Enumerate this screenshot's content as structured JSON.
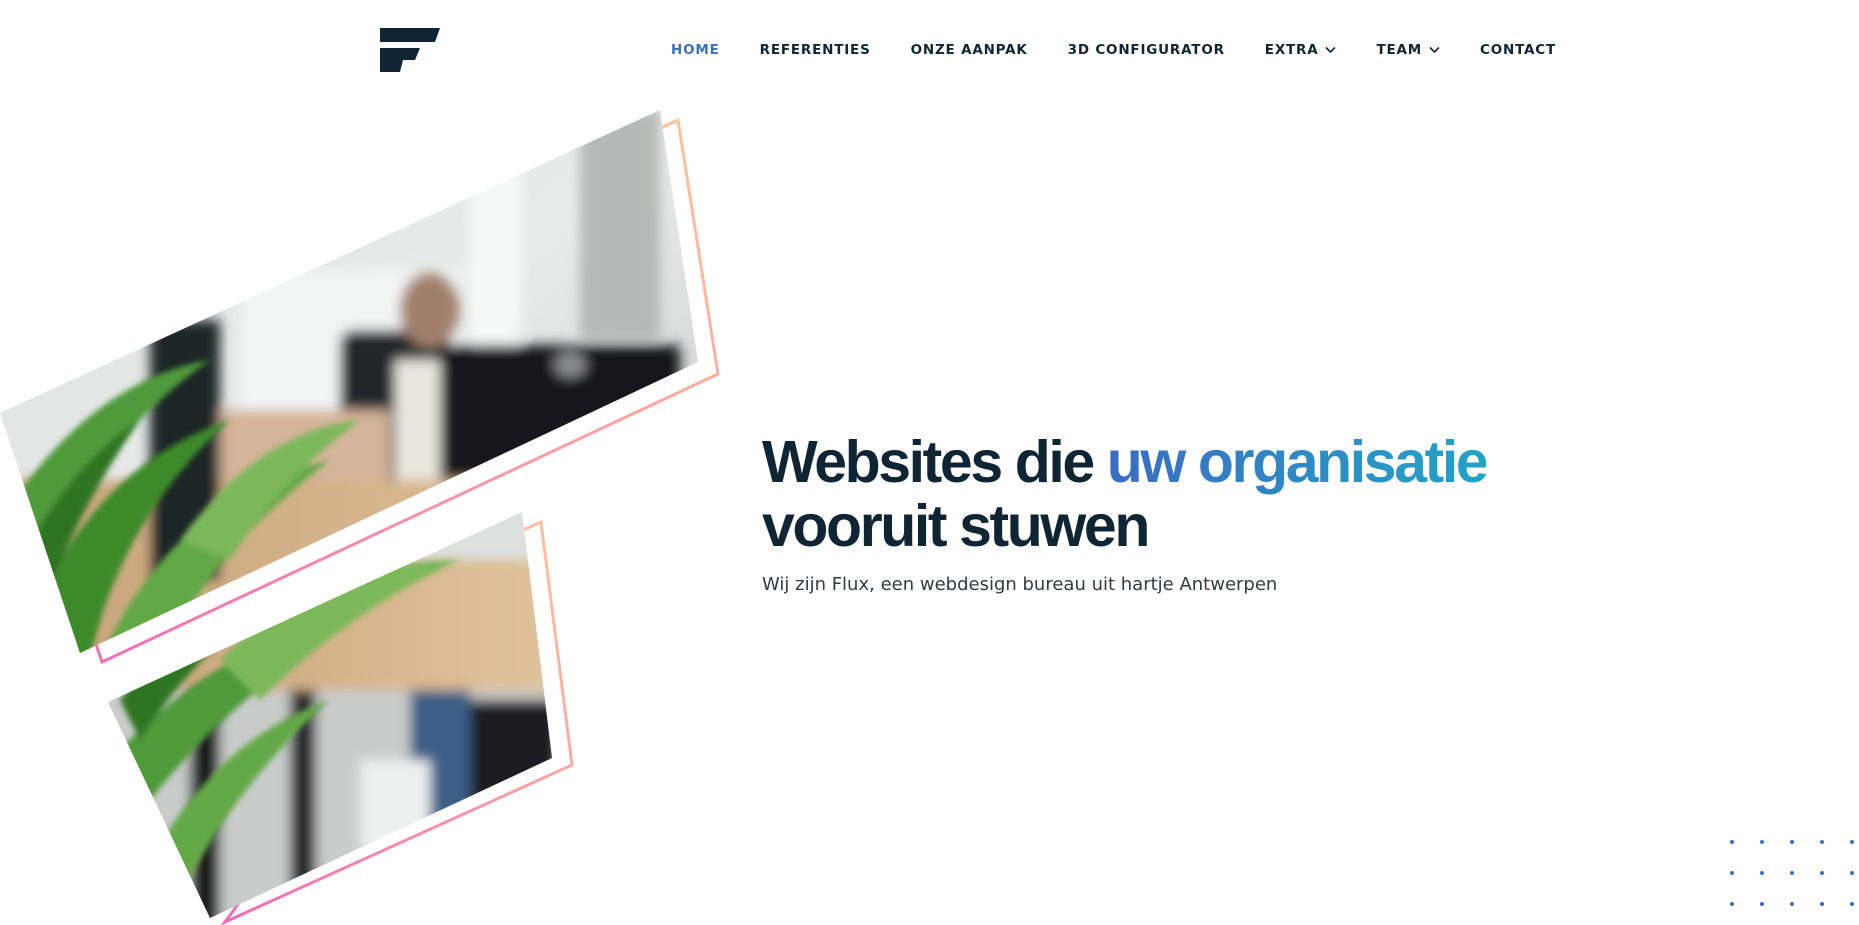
{
  "brand": {
    "logo_icon": "flux-logo-icon",
    "primary_color": "#0f2533",
    "accent_color": "#3a6fc1",
    "gradient_colors": [
      "#3b6cc4",
      "#23a3c6"
    ],
    "frame_gradient": [
      "#f06bb8",
      "#ffc49a"
    ]
  },
  "nav": {
    "items": [
      {
        "label": "HOME",
        "active": true
      },
      {
        "label": "REFERENTIES"
      },
      {
        "label": "ONZE AANPAK"
      },
      {
        "label": "3D CONFIGURATOR"
      },
      {
        "label": "EXTRA",
        "dropdown": true,
        "icon": "chevron-down-icon"
      },
      {
        "label": "TEAM",
        "dropdown": true,
        "icon": "chevron-down-icon"
      },
      {
        "label": "CONTACT"
      }
    ]
  },
  "hero": {
    "headline_part1": "Websites die ",
    "headline_highlight": "uw organisatie",
    "headline_part2": "vooruit stuwen",
    "subtitle": "Wij zijn Flux, een webdesign bureau uit hartje Antwerpen",
    "images": [
      {
        "description_icon": "office-photo-icon"
      },
      {
        "description_icon": "desk-photo-icon"
      }
    ]
  },
  "decor": {
    "dots_icon": "dot-grid-icon",
    "dots_color": "#3a6fc1"
  }
}
